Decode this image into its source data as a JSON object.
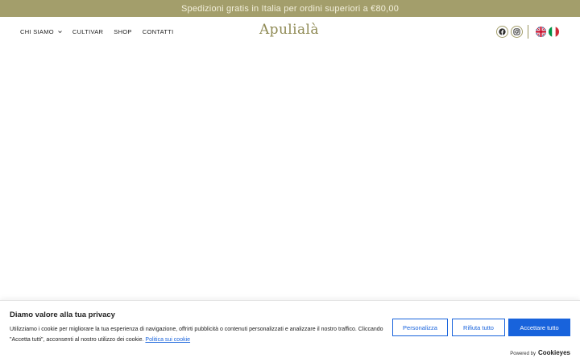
{
  "promo_bar": {
    "text": "Spedizioni gratis in Italia per ordini superiori a €80,00"
  },
  "header": {
    "nav": [
      {
        "label": "CHI SIAMO",
        "has_dropdown": true
      },
      {
        "label": "CULTIVAR"
      },
      {
        "label": "SHOP"
      },
      {
        "label": "CONTATTI"
      }
    ],
    "logo": "Apulialà",
    "social": [
      "facebook-icon",
      "instagram-icon"
    ],
    "languages": [
      "uk-flag-icon",
      "italy-flag-icon"
    ]
  },
  "cookie_banner": {
    "title": "Diamo valore alla tua privacy",
    "text": "Utilizziamo i cookie per migliorare la tua esperienza di navigazione, offrirti pubblicità o contenuti personalizzati e analizzare il nostro traffico. Cliccando \"Accetta tutti\", acconsenti al nostro utilizzo dei cookie.",
    "policy_link": "Politica sui cookie",
    "buttons": {
      "customize": "Personalizza",
      "reject": "Rifiuta tutto",
      "accept": "Accettare tutto"
    },
    "powered_by": "Powered by",
    "powered_brand": "Cookieyes"
  },
  "colors": {
    "promo_bg": "#a39e6b",
    "accent": "#8f8a54",
    "button_blue": "#1863dc"
  }
}
